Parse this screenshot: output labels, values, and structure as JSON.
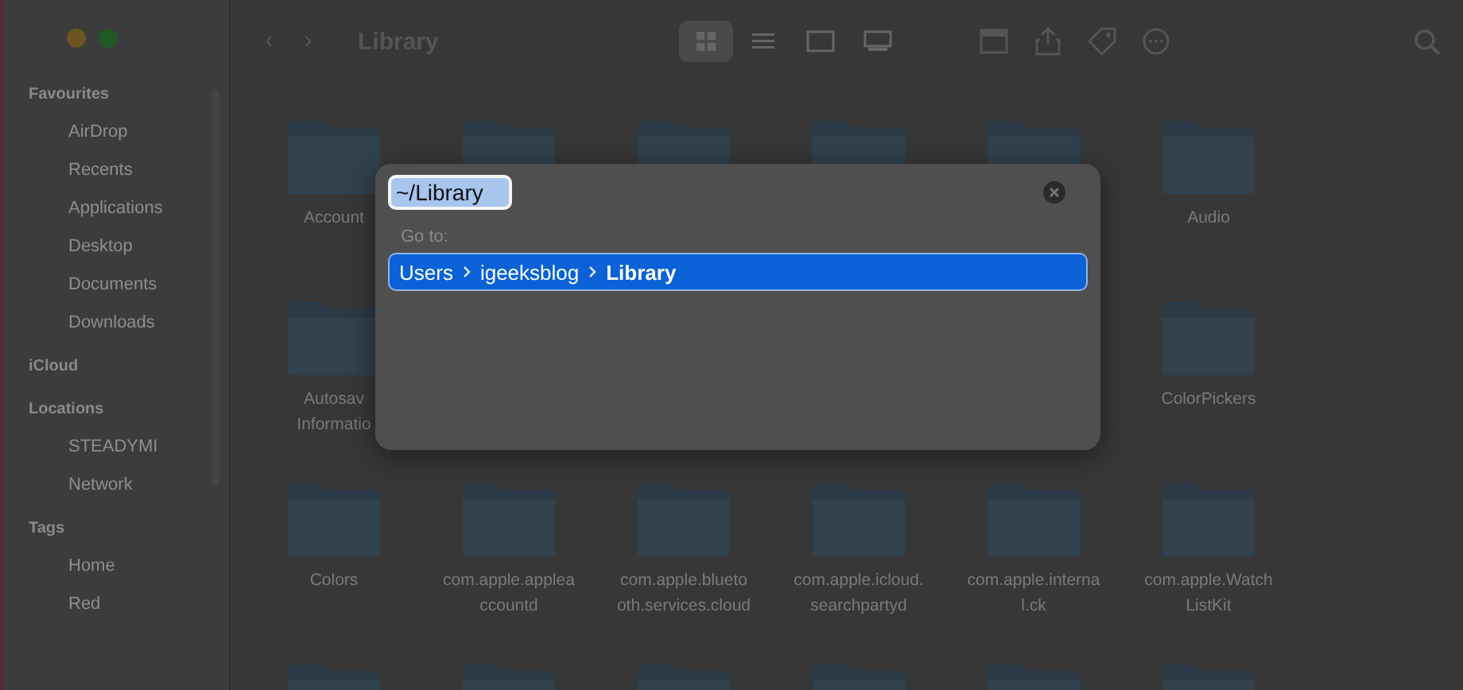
{
  "window": {
    "title": "Library"
  },
  "sidebar": {
    "sections": [
      {
        "heading": "Favourites",
        "items": [
          "AirDrop",
          "Recents",
          "Applications",
          "Desktop",
          "Documents",
          "Downloads"
        ]
      },
      {
        "heading": "iCloud"
      },
      {
        "heading": "Locations",
        "items": [
          "STEADYMI",
          "Network"
        ]
      },
      {
        "heading": "Tags",
        "items": [
          "Home",
          "Red"
        ]
      }
    ]
  },
  "toolbar": {
    "views": [
      {
        "kind": "icons",
        "selected": true
      },
      {
        "kind": "list",
        "selected": false
      },
      {
        "kind": "columns",
        "selected": false
      },
      {
        "kind": "gallery",
        "selected": false
      }
    ]
  },
  "grid": {
    "rows": [
      [
        {
          "label": [
            "Account"
          ]
        },
        {},
        {},
        {},
        {},
        {
          "label": [
            "Audio"
          ]
        }
      ],
      [
        {
          "label": [
            "Autosav",
            "Informatio"
          ]
        },
        null,
        null,
        null,
        null,
        {
          "label": [
            "ColorPickers"
          ]
        }
      ],
      [
        {
          "label": [
            "Colors"
          ]
        },
        {
          "label": [
            "com.apple.applea",
            "ccountd"
          ]
        },
        {
          "label": [
            "com.apple.blueto",
            "oth.services.cloud"
          ]
        },
        {
          "label": [
            "com.apple.icloud.",
            "searchpartyd"
          ]
        },
        {
          "label": [
            "com.apple.interna",
            "l.ck"
          ]
        },
        {
          "label": [
            "com.apple.Watch",
            "ListKit"
          ]
        }
      ],
      [
        {},
        {},
        {},
        {},
        {},
        {}
      ]
    ]
  },
  "dialog": {
    "field_value": "~/Library",
    "go_to_label": "Go to:",
    "suggestions": [
      {
        "segments": [
          "Users",
          "igeeksblog",
          "Library"
        ],
        "selected": true
      }
    ]
  }
}
